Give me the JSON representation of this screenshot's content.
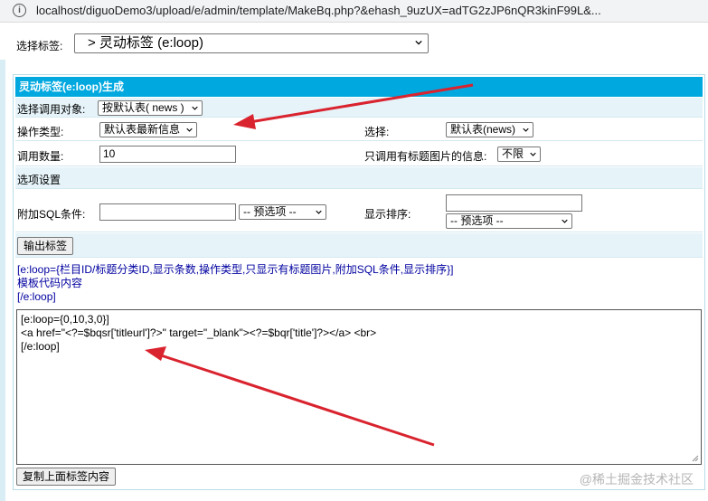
{
  "browser": {
    "info_icon": "info-icon",
    "url": "localhost/diguoDemo3/upload/e/admin/template/MakeBq.php?&ehash_9uzUX=adTG2zJP6nQR3kinF99L&..."
  },
  "tag_select": {
    "label": "选择标签:",
    "value": "> 灵动标签 (e:loop)"
  },
  "panel": {
    "title": "灵动标签(e:loop)生成",
    "call_object": {
      "label": "选择调用对象:",
      "value": "按默认表( news )"
    },
    "op_type": {
      "label": "操作类型:",
      "value": "默认表最新信息"
    },
    "choose": {
      "label": "选择:",
      "value": "默认表(news)"
    },
    "count": {
      "label": "调用数量:",
      "value": "10"
    },
    "only_pic": {
      "label": "只调用有标题图片的信息:",
      "value": "不限"
    },
    "options_title": "选项设置",
    "sql": {
      "label": "附加SQL条件:",
      "value": "",
      "preset": "-- 预选项 --"
    },
    "order": {
      "label": "显示排序:",
      "value": "",
      "preset": "-- 预选项 --"
    },
    "output_button": "输出标签",
    "syntax_lines": [
      "[e:loop={栏目ID/标题分类ID,显示条数,操作类型,只显示有标题图片,附加SQL条件,显示排序}]",
      "模板代码内容",
      "[/e:loop]"
    ],
    "code_lines": [
      "[e:loop={0,10,3,0}]",
      "<a href=\"<?=$bqsr['titleurl']?>\" target=\"_blank\"><?=$bqr['title']?></a> <br>",
      "[/e:loop]"
    ],
    "copy_button": "复制上面标签内容"
  },
  "watermark": "@稀土掘金技术社区",
  "colors": {
    "header": "#00a8e0",
    "annotation_arrow": "#d9232e",
    "row_light": "#e6f4fa"
  }
}
